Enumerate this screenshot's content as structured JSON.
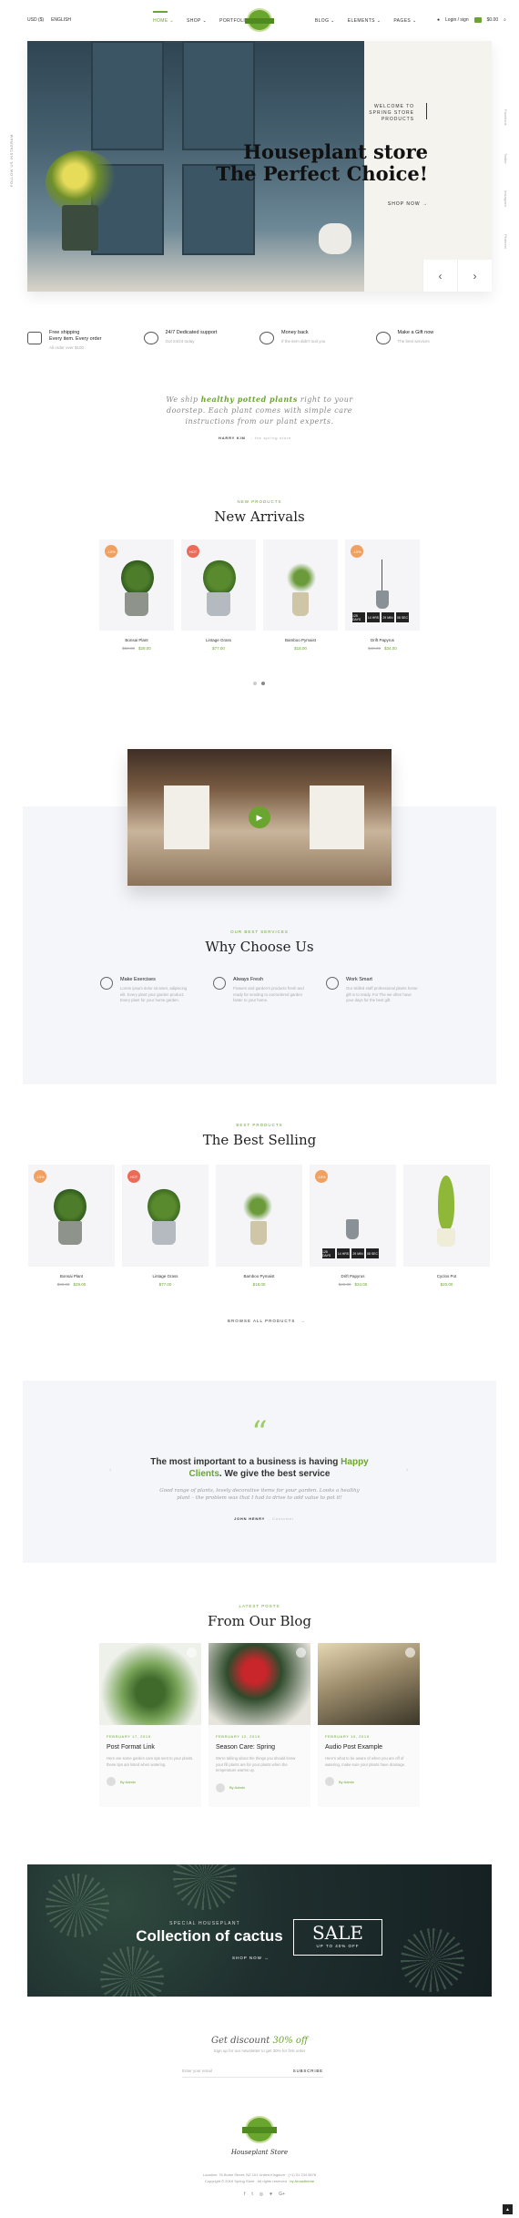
{
  "header": {
    "links": [
      "USD ($)",
      "ENGLISH"
    ],
    "nav": [
      "HOME",
      "SHOP",
      "PORTFOLIO",
      "BLOG",
      "ELEMENTS",
      "PAGES"
    ],
    "nav_suffix": "⌄",
    "login": "Login / sign",
    "cart_total": "$0.00",
    "brand_accent": "#6aa52f"
  },
  "hero": {
    "side_social_left": "FOLLOW US INSTAGRAM",
    "side_social_right": [
      "Facebook",
      "Twitter",
      "Instagram",
      "Pinterest"
    ],
    "small": "WELCOME TO SPRING STORE PRODUCTS",
    "title_line1": "Houseplant store",
    "title_line2": "The Perfect Choice!",
    "button": "SHOP NOW →",
    "prev": "‹",
    "next": "›"
  },
  "features": [
    {
      "title": "Free shipping",
      "title2": "Every item. Every order",
      "desc": "All order over $100",
      "icon": "truck-icon"
    },
    {
      "title": "24/7 Dedicated support",
      "title2": "",
      "desc": "Got 24/24 today",
      "icon": "phone-icon"
    },
    {
      "title": "Money back",
      "title2": "",
      "desc": "If the item didn't suit you",
      "icon": "money-icon"
    },
    {
      "title": "Make a Gift now",
      "title2": "",
      "desc": "The best services",
      "icon": "gift-icon"
    }
  ],
  "intro": {
    "text_pre": "We ship ",
    "text_highlight": "healthy potted plants",
    "text_post": " right to your doorstep. Each plant comes with simple care instructions from our plant experts.",
    "sign_name": "HARRY KIM",
    "sign_role": "- the spring store"
  },
  "new_arrivals": {
    "small": "NEW PRODUCTS",
    "title": "New Arrivals",
    "products": [
      {
        "name": "Bonsai Plant",
        "old": "$60.00",
        "price": "$29.00",
        "badge": "-15%",
        "badge_color": "#f0a060"
      },
      {
        "name": "Lintage Grass",
        "old": "",
        "price": "$77.00",
        "badge": "HOT",
        "badge_color": "#ee6a58"
      },
      {
        "name": "Bamboo Pymaist",
        "old": "",
        "price": "$18.00",
        "badge": "",
        "badge_color": ""
      },
      {
        "name": "Drift Papyrus",
        "old": "$40.00",
        "price": "$34.00",
        "badge": "-15%",
        "badge_color": "#f0a060"
      }
    ],
    "countdown": [
      "125 DAYS",
      "14 HRS",
      "29 MIN",
      "08 SEC"
    ]
  },
  "why": {
    "small": "OUR BEST SERVICES",
    "title": "Why Choose Us",
    "items": [
      {
        "title": "Make Exercises",
        "desc": "Lorem ipsum dolor sit amet, adipiscing elit. Every plant your garden product; Every plant for your home garden."
      },
      {
        "title": "Always Fresh",
        "desc": "Flowers and garden's products fresh and ready for sending to our/ordered garden faster to your home."
      },
      {
        "title": "Work Smart",
        "desc": "Our skilled staff professional plants home gift is to ready. For The we often have your days for the best gift."
      }
    ]
  },
  "best_selling": {
    "small": "BEST PRODUCTS",
    "title": "The Best Selling",
    "products": [
      {
        "name": "Bonsai Plant",
        "old": "$60.00",
        "price": "$29.00",
        "badge": "-15%",
        "badge_color": "#f0a060"
      },
      {
        "name": "Lintage Grass",
        "old": "",
        "price": "$77.00",
        "badge": "HOT",
        "badge_color": "#ee6a58"
      },
      {
        "name": "Bamboo Pymaist",
        "old": "",
        "price": "$18.00",
        "badge": "",
        "badge_color": ""
      },
      {
        "name": "Drift Papyrus",
        "old": "$40.00",
        "price": "$34.00",
        "badge": "-15%",
        "badge_color": "#f0a060"
      },
      {
        "name": "Cyclos Pot",
        "old": "",
        "price": "$20.00",
        "badge": "",
        "badge_color": ""
      }
    ],
    "browse": "BROWSE ALL PRODUCTS",
    "browse_arrow": "→"
  },
  "testimonial": {
    "quote_mark": "“",
    "title_pre": "The most important to a business is having ",
    "title_highlight": "Happy Clients",
    "title_post": ". We give the best service",
    "body": "Good range of plants, lovely decorative items for your garden. Looks a healthy plant – the problem was that I had to drive to add value to pot it!",
    "author": "JOHN HENRY",
    "author_role": "- Customer",
    "prev": "‹",
    "next": "›"
  },
  "blog": {
    "small": "LATEST POSTS",
    "title": "From Our Blog",
    "posts": [
      {
        "date": "FEBRUARY 17, 2019",
        "title": "Post Format Link",
        "desc": "Here are some garden care tips sent to your plants, these tips are listed when watering.",
        "author": "By Admin"
      },
      {
        "date": "FEBRUARY 12, 2019",
        "title": "Season Care: Spring",
        "desc": "We're talking about the things you should know your fill plants are for your plants when the temperature warms up.",
        "author": "By Admin"
      },
      {
        "date": "FEBRUARY 10, 2019",
        "title": "Audio Post Example",
        "desc": "Here's what to be aware of when you are off of watering, make sure your plants have drainage.",
        "author": "By Admin"
      }
    ]
  },
  "sale": {
    "small": "SPECIAL HOUSEPLANT",
    "title": "Collection of cactus",
    "button": "SHOP NOW →",
    "box_big": "SALE",
    "box_small": "UP TO 40% OFF"
  },
  "newsletter": {
    "title_pre": "Get discount ",
    "title_highlight": "30% off",
    "sub": "Sign up for our newsletter to get 30% for first order",
    "placeholder": "Enter your email",
    "button": "SUBSCRIBE"
  },
  "footer": {
    "logo_text": "SPRING",
    "name": "Houseplant Store",
    "address": "Location: 76 Burke Street, NZ 101 United Kingdom · (+1) 01 234 5678",
    "copyright_pre": "Copyright © 2019 Spring Store · All rights reserved · ",
    "copyright_brand": "by Arrowtheme",
    "social": [
      "f",
      "t",
      "◎",
      "♥",
      "G+"
    ],
    "to_top": "▲"
  }
}
